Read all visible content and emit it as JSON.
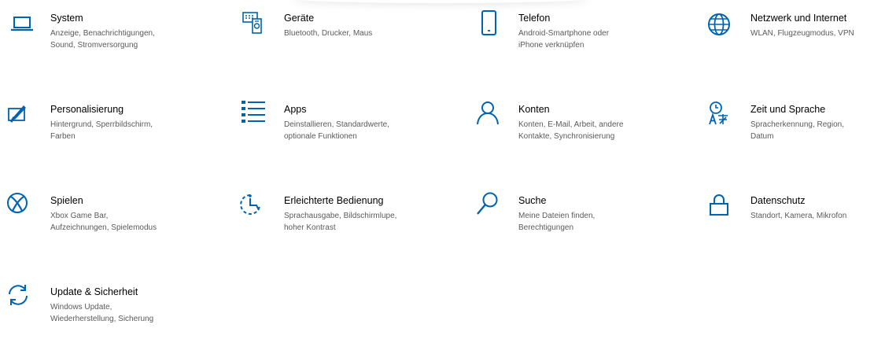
{
  "accent_color": "#0063b1",
  "tiles": [
    {
      "name": "system",
      "icon": "laptop-icon",
      "title": "System",
      "desc": [
        "Anzeige, Benachrichtigungen,",
        "Sound, Stromversorgung"
      ]
    },
    {
      "name": "geraete",
      "icon": "devices-icon",
      "title": "Geräte",
      "desc": [
        "Bluetooth, Drucker, Maus"
      ]
    },
    {
      "name": "telefon",
      "icon": "phone-icon",
      "title": "Telefon",
      "desc": [
        "Android-Smartphone oder",
        "iPhone verknüpfen"
      ]
    },
    {
      "name": "netzwerk",
      "icon": "globe-icon",
      "title": "Netzwerk und Internet",
      "desc": [
        "WLAN, Flugzeugmodus, VPN"
      ]
    },
    {
      "name": "personalisierung",
      "icon": "paint-icon",
      "title": "Personalisierung",
      "desc": [
        "Hintergrund, Sperrbildschirm,",
        "Farben"
      ]
    },
    {
      "name": "apps",
      "icon": "apps-list-icon",
      "title": "Apps",
      "desc": [
        "Deinstallieren, Standardwerte,",
        "optionale Funktionen"
      ]
    },
    {
      "name": "konten",
      "icon": "person-icon",
      "title": "Konten",
      "desc": [
        "Konten, E-Mail, Arbeit, andere",
        "Kontakte, Synchronisierung"
      ]
    },
    {
      "name": "zeit-sprache",
      "icon": "time-language-icon",
      "title": "Zeit und Sprache",
      "desc": [
        "Spracherkennung, Region,",
        "Datum"
      ]
    },
    {
      "name": "spielen",
      "icon": "xbox-icon",
      "title": "Spielen",
      "desc": [
        "Xbox Game Bar,",
        "Aufzeichnungen, Spielemodus"
      ]
    },
    {
      "name": "erleichterte-bedienung",
      "icon": "ease-of-access-icon",
      "title": "Erleichterte Bedienung",
      "desc": [
        "Sprachausgabe, Bildschirmlupe,",
        "hoher Kontrast"
      ]
    },
    {
      "name": "suche",
      "icon": "search-icon",
      "title": "Suche",
      "desc": [
        "Meine Dateien finden,",
        "Berechtigungen"
      ]
    },
    {
      "name": "datenschutz",
      "icon": "lock-icon",
      "title": "Datenschutz",
      "desc": [
        "Standort, Kamera, Mikrofon"
      ]
    },
    {
      "name": "update-sicherheit",
      "icon": "sync-icon",
      "title": "Update & Sicherheit",
      "desc": [
        "Windows Update,",
        "Wiederherstellung, Sicherung"
      ]
    }
  ]
}
